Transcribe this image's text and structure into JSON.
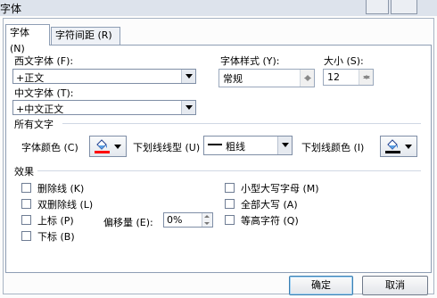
{
  "window": {
    "title": "字体"
  },
  "tabs": [
    {
      "label": "字体 (N)"
    },
    {
      "label": "字符间距 (R)"
    }
  ],
  "font": {
    "western_label": "西文字体 (F):",
    "western_value": "+正文",
    "asian_label": "中文字体 (T):",
    "asian_value": "+中文正文",
    "style_label": "字体样式 (Y):",
    "style_value": "常规",
    "size_label": "大小 (S):",
    "size_value": "12"
  },
  "all_text": {
    "heading": "所有文字",
    "font_color_label": "字体颜色 (C)",
    "font_color": "#ff0000",
    "underline_style_label": "下划线线型 (U)",
    "underline_style_value": "粗线",
    "underline_color_label": "下划线颜色 (I)",
    "underline_color": "#000000"
  },
  "effects": {
    "heading": "效果",
    "strikethrough": "删除线 (K)",
    "double_strikethrough": "双删除线 (L)",
    "superscript": "上标 (P)",
    "subscript": "下标 (B)",
    "offset_label": "偏移量 (E):",
    "offset_value": "0%",
    "small_caps": "小型大写字母 (M)",
    "all_caps": "全部大写 (A)",
    "equalize_height": "等高字符 (Q)"
  },
  "buttons": {
    "ok": "确定",
    "cancel": "取消"
  }
}
